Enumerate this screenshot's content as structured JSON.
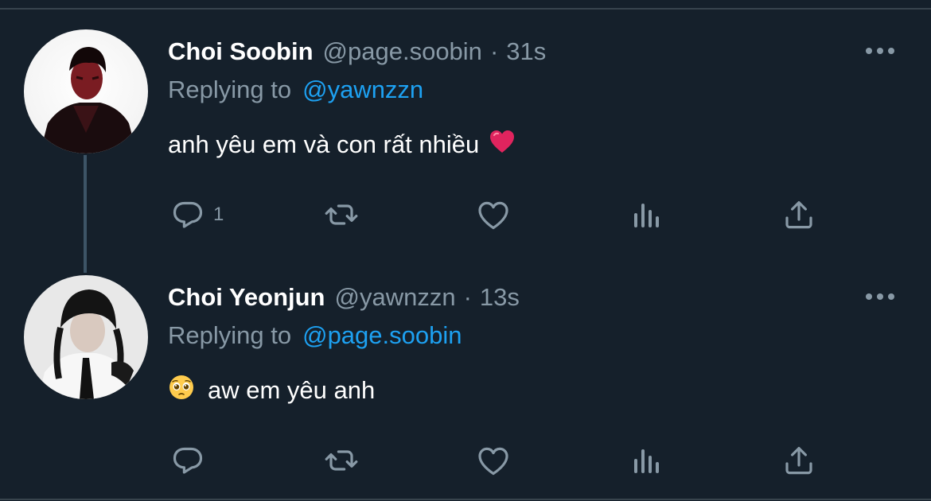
{
  "colors": {
    "background": "#15202b",
    "divider": "#38444d",
    "thread_line": "#3d5466",
    "secondary_text": "#8899a6",
    "link": "#1da1f2",
    "heart_emoji": "#e0245e"
  },
  "tweets": [
    {
      "display_name": "Choi Soobin",
      "handle": "@page.soobin",
      "separator": "·",
      "time": "31s",
      "replying_label": "Replying to",
      "replying_to": "@yawnzzn",
      "text": "anh yêu em và con rất nhiều",
      "text_emoji": "red-heart-emoji",
      "reply_count": "1",
      "actions": [
        "reply-icon",
        "retweet-icon",
        "like-icon",
        "analytics-icon",
        "share-icon"
      ]
    },
    {
      "display_name": "Choi Yeonjun",
      "handle": "@yawnzzn",
      "separator": "·",
      "time": "13s",
      "replying_label": "Replying to",
      "replying_to": "@page.soobin",
      "text_emoji": "pleading-face-emoji",
      "text": "aw em yêu anh",
      "reply_count": "",
      "actions": [
        "reply-icon",
        "retweet-icon",
        "like-icon",
        "analytics-icon",
        "share-icon"
      ]
    }
  ]
}
